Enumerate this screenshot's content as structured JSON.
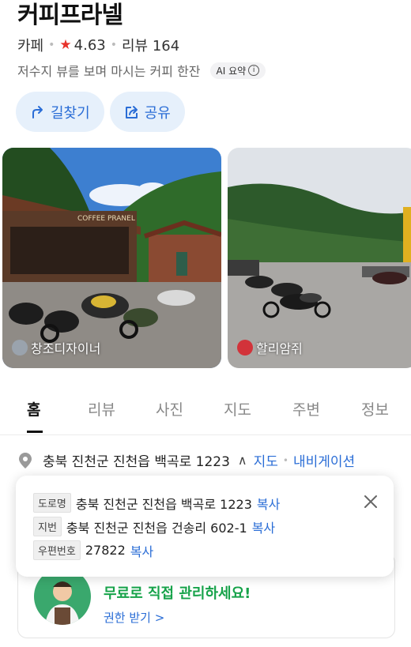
{
  "place": {
    "name": "커피프라넬",
    "category": "카페",
    "rating": "4.63",
    "review_label": "리뷰 164",
    "summary": "저수지 뷰를 보며 마시는 커피 한잔",
    "ai_badge": "AI 요약"
  },
  "actions": {
    "directions": "길찾기",
    "share": "공유"
  },
  "photos": [
    {
      "credit": "창조디자이너",
      "sign": "COFFEE PRANEL"
    },
    {
      "credit": "할리암쥐"
    }
  ],
  "tabs": [
    "홈",
    "리뷰",
    "사진",
    "지도",
    "주변",
    "정보"
  ],
  "address": {
    "main": "충북 진천군 진천읍 백곡로 1223",
    "map_link": "지도",
    "nav_link": "내비게이션"
  },
  "popup": {
    "road_tag": "도로명",
    "road": "충북 진천군 진천읍 백곡로 1223",
    "lot_tag": "지번",
    "lot": "충북 진천군 진천읍 건송리 602-1",
    "zip_tag": "우편번호",
    "zip": "27822",
    "copy": "복사"
  },
  "owner_card": {
    "message": "무료로 직접 관리하세요!",
    "link": "권한 받기 >"
  },
  "colors": {
    "accent": "#2a6dd6",
    "star": "#e8322b",
    "green": "#17a34a"
  }
}
